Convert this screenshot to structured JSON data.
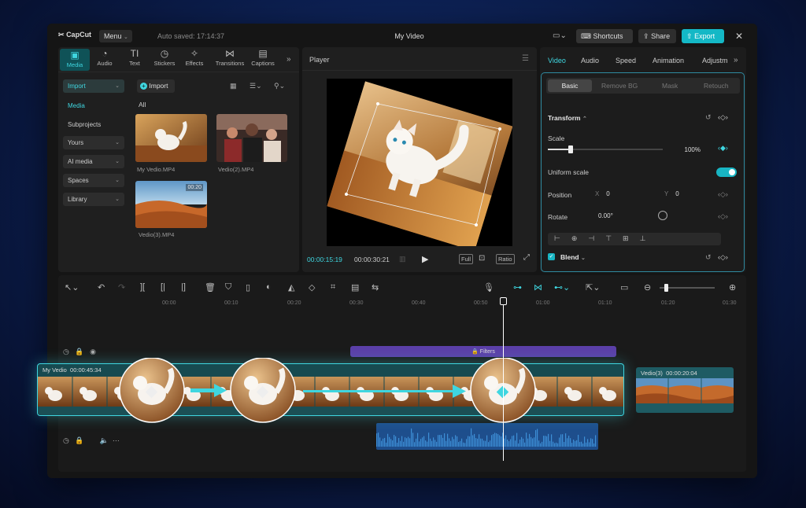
{
  "app": {
    "logo": "CapCut",
    "menu_label": "Menu",
    "autosave": "Auto saved: 17:14:37",
    "doc_title": "My Video",
    "shortcuts_label": "Shortcuts",
    "share_label": "Share",
    "export_label": "Export"
  },
  "media_tabs": [
    "Media",
    "Audio",
    "Text",
    "Stickers",
    "Effects",
    "Transitions",
    "Captions"
  ],
  "sidebar": {
    "import_label": "Import",
    "items": [
      "Media",
      "Subprojects",
      "Yours",
      "AI media",
      "Spaces",
      "Library"
    ]
  },
  "media": {
    "import_button": "Import",
    "filter_label": "All",
    "clips": [
      {
        "name": "My Vedio.MP4",
        "duration": ""
      },
      {
        "name": "Vedio(2).MP4",
        "duration": ""
      },
      {
        "name": "Vedio(3).MP4",
        "duration": "00:20"
      }
    ]
  },
  "player": {
    "title": "Player",
    "current_time": "00:00:15:19",
    "total_time": "00:00:30:21",
    "full_label": "Full",
    "ratio_label": "Ratio"
  },
  "inspector": {
    "tabs": [
      "Video",
      "Audio",
      "Speed",
      "Animation",
      "Adjustm"
    ],
    "subtabs": [
      "Basic",
      "Remove BG",
      "Mask",
      "Retouch"
    ],
    "transform_label": "Transform",
    "scale_label": "Scale",
    "scale_value": "100%",
    "scale_fraction": 0.2,
    "uniform_label": "Uniform scale",
    "position_label": "Position",
    "x_label": "X",
    "x_value": "0",
    "y_label": "Y",
    "y_value": "0",
    "rotate_label": "Rotate",
    "rotate_value": "0.00°",
    "blend_label": "Blend"
  },
  "timeline": {
    "ruler": [
      "00:00",
      "00:10",
      "00:20",
      "00:30",
      "00:40",
      "00:50",
      "01:00",
      "01:10",
      "01:20",
      "01:30"
    ],
    "filters_label": "Filters",
    "main_clip_name": "My Vedio",
    "main_clip_duration": "00:00:45:34",
    "second_clip_name": "Vedio(3)",
    "second_clip_duration": "00:00:20:04"
  },
  "colors": {
    "accent": "#3fd6e0",
    "filter_track": "#5b3fa8",
    "audio_track": "#1e4e8c"
  }
}
